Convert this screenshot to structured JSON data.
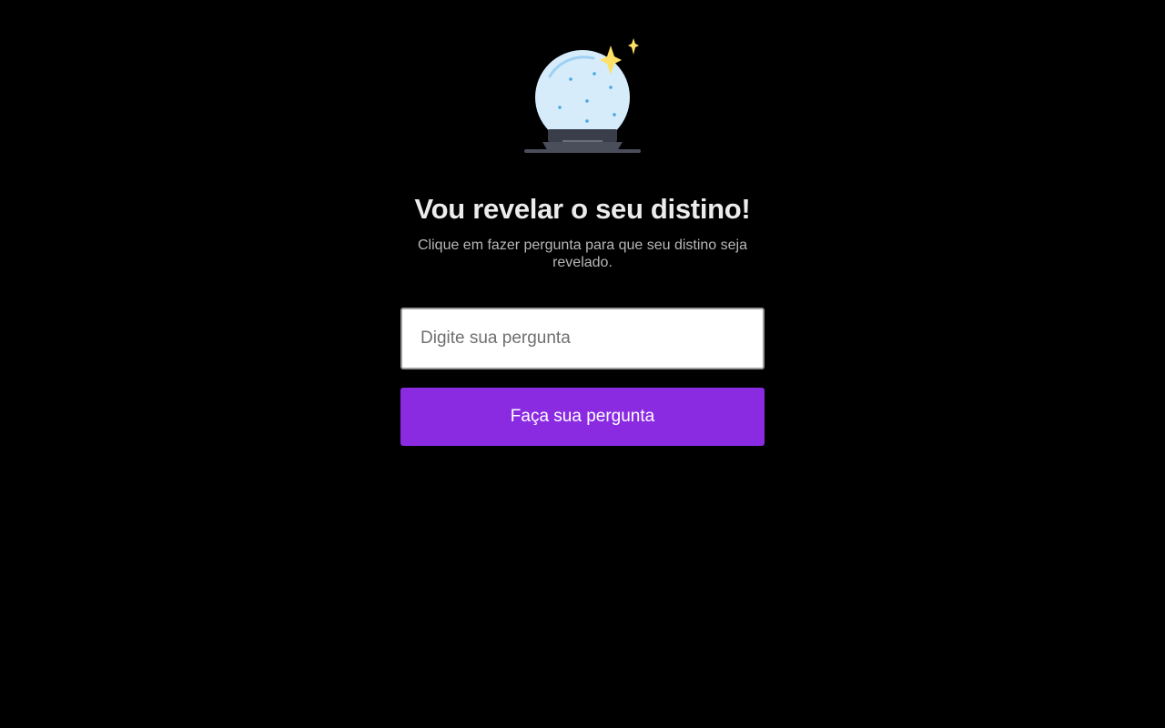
{
  "hero": {
    "icon": "crystal-ball-icon",
    "colors": {
      "globe": "#d6ecfb",
      "globe_dots": "#4aa8e0",
      "sparkle": "#ffe066",
      "base": "#3a3d4a"
    }
  },
  "header": {
    "title": "Vou revelar o seu distino!",
    "subtitle": "Clique em fazer pergunta para que seu distino seja revelado."
  },
  "form": {
    "question_placeholder": "Digite sua pergunta",
    "question_value": "",
    "submit_label": "Faça sua pergunta"
  },
  "theme": {
    "background": "#000000",
    "accent": "#8a2be2"
  }
}
